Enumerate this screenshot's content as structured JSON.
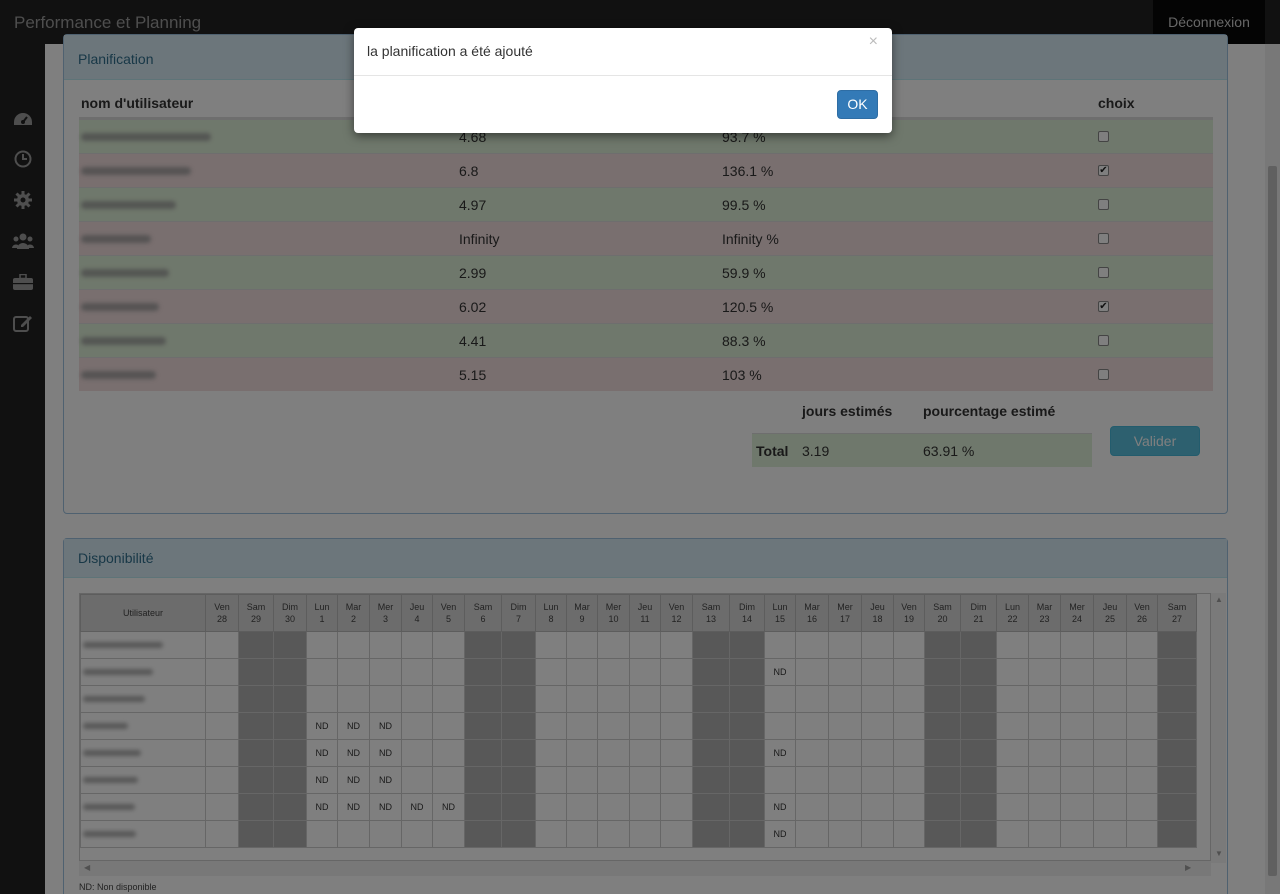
{
  "app": {
    "title": "Performance et Planning",
    "logout_label": "Déconnexion"
  },
  "sidebar": {
    "icons": [
      "dashboard-icon",
      "clock-icon",
      "gear-icon",
      "users-icon",
      "briefcase-icon",
      "edit-icon"
    ]
  },
  "planification": {
    "title": "Planification",
    "col_user": "nom d'utilisateur",
    "col_choice": "choix",
    "rows": [
      {
        "days": "4.68",
        "pct": "93.7 %",
        "checked": false,
        "status": "ok"
      },
      {
        "days": "6.8",
        "pct": "136.1 %",
        "checked": true,
        "status": "ko"
      },
      {
        "days": "4.97",
        "pct": "99.5 %",
        "checked": false,
        "status": "ok"
      },
      {
        "days": "Infinity",
        "pct": "Infinity %",
        "checked": false,
        "status": "ko"
      },
      {
        "days": "2.99",
        "pct": "59.9 %",
        "checked": false,
        "status": "ok"
      },
      {
        "days": "6.02",
        "pct": "120.5 %",
        "checked": true,
        "status": "ko"
      },
      {
        "days": "4.41",
        "pct": "88.3 %",
        "checked": false,
        "status": "ok"
      },
      {
        "days": "5.15",
        "pct": "103 %",
        "checked": false,
        "status": "ko"
      }
    ],
    "totals": {
      "days_label": "jours estimés",
      "pct_label": "pourcentage estimé",
      "row_label": "Total",
      "days": "3.19",
      "pct": "63.91 %"
    },
    "submit_label": "Valider"
  },
  "disponibilite": {
    "title": "Disponibilité",
    "user_col": "Utilisateur",
    "days": [
      [
        "Ven",
        "28"
      ],
      [
        "Sam",
        "29"
      ],
      [
        "Dim",
        "30"
      ],
      [
        "Lun",
        "1"
      ],
      [
        "Mar",
        "2"
      ],
      [
        "Mer",
        "3"
      ],
      [
        "Jeu",
        "4"
      ],
      [
        "Ven",
        "5"
      ],
      [
        "Sam",
        "6"
      ],
      [
        "Dim",
        "7"
      ],
      [
        "Lun",
        "8"
      ],
      [
        "Mar",
        "9"
      ],
      [
        "Mer",
        "10"
      ],
      [
        "Jeu",
        "11"
      ],
      [
        "Ven",
        "12"
      ],
      [
        "Sam",
        "13"
      ],
      [
        "Dim",
        "14"
      ],
      [
        "Lun",
        "15"
      ],
      [
        "Mar",
        "16"
      ],
      [
        "Mer",
        "17"
      ],
      [
        "Jeu",
        "18"
      ],
      [
        "Ven",
        "19"
      ],
      [
        "Sam",
        "20"
      ],
      [
        "Dim",
        "21"
      ],
      [
        "Lun",
        "22"
      ],
      [
        "Mar",
        "23"
      ],
      [
        "Mer",
        "24"
      ],
      [
        "Jeu",
        "25"
      ],
      [
        "Ven",
        "26"
      ],
      [
        "Sam",
        "27"
      ]
    ],
    "nd_label": "ND",
    "rows": [
      [],
      [
        "Lun 15"
      ],
      [],
      [
        "Lun 1",
        "Mar 2",
        "Mer 3"
      ],
      [
        "Lun 1",
        "Mar 2",
        "Mer 3",
        "Lun 15"
      ],
      [
        "Lun 1",
        "Mar 2",
        "Mer 3"
      ],
      [
        "Lun 1",
        "Mar 2",
        "Mer 3",
        "Jeu 4",
        "Ven 5",
        "Lun 15"
      ],
      [
        "Lun 15"
      ]
    ],
    "legend": "ND: Non disponible"
  },
  "modal": {
    "message": "la planification a été ajouté",
    "close_symbol": "×",
    "ok_label": "OK"
  }
}
